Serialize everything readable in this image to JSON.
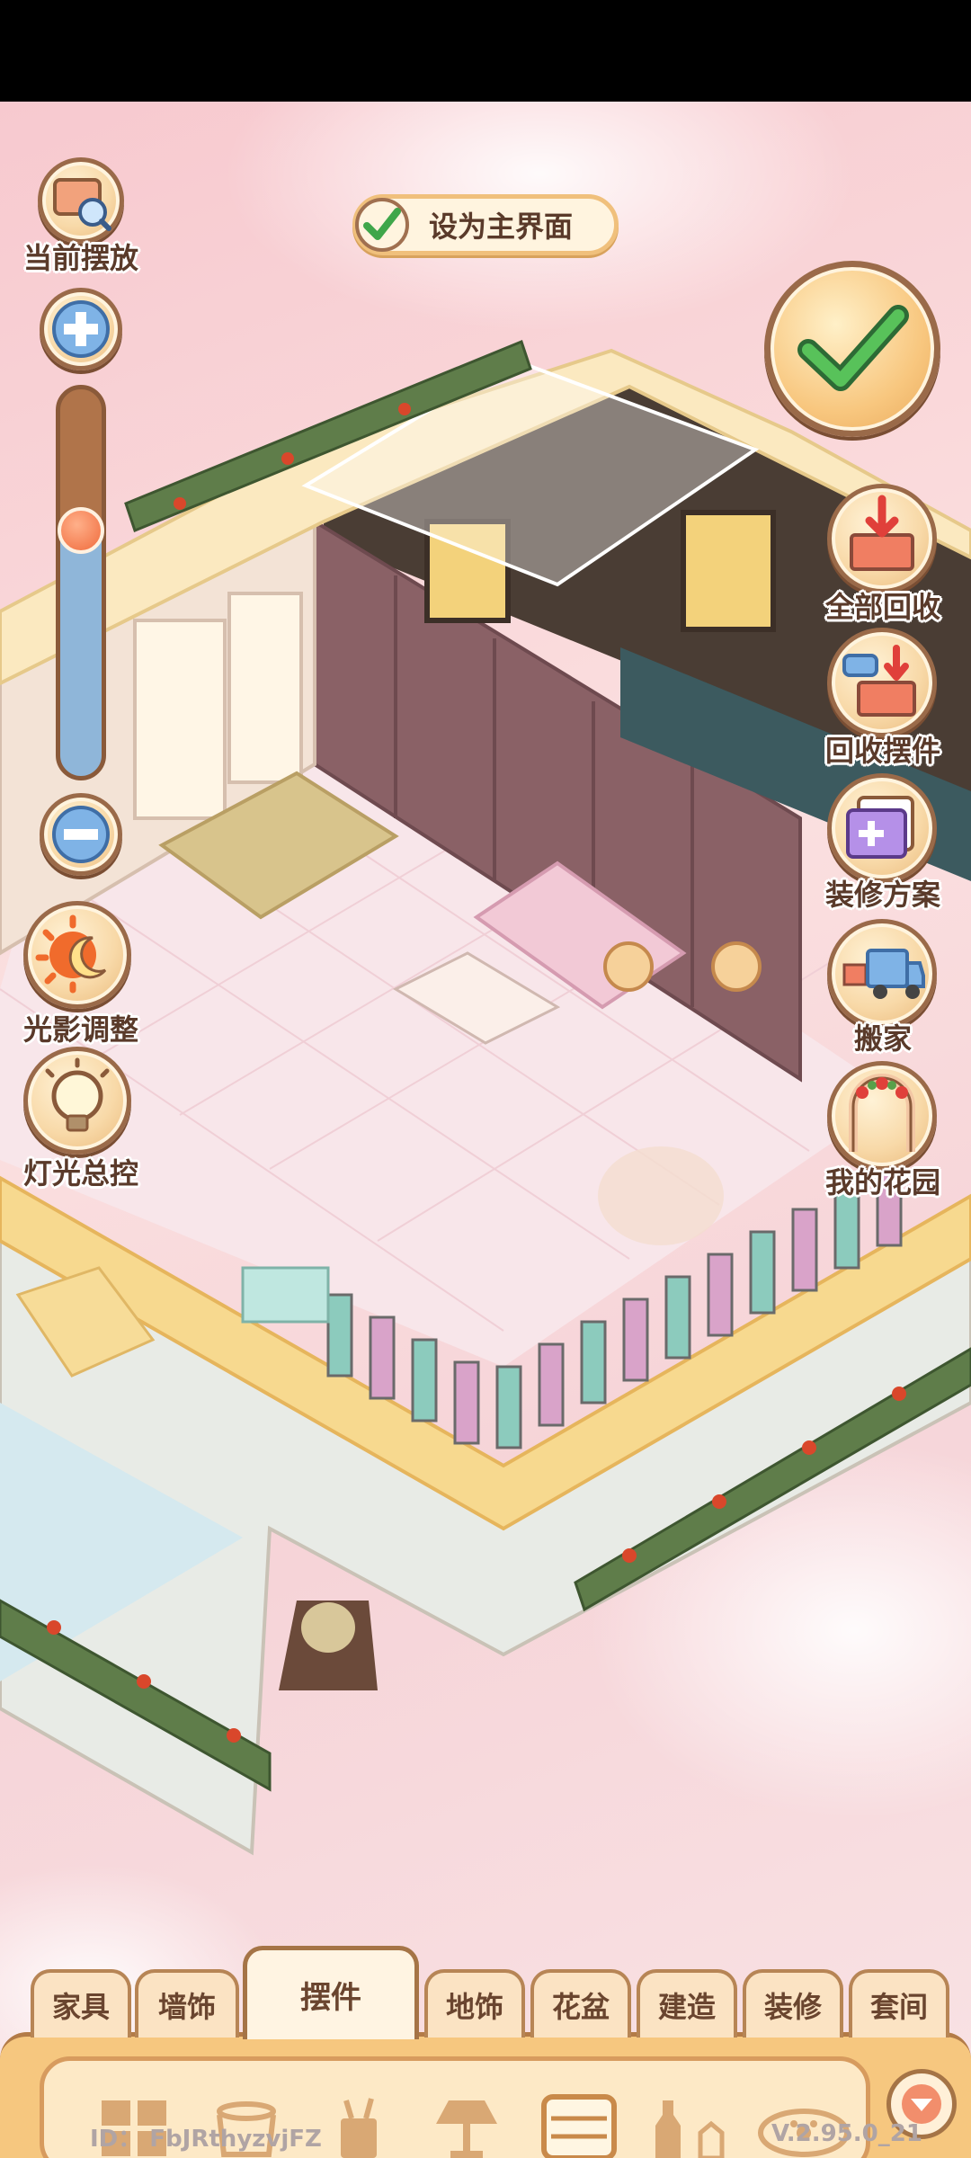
{
  "top_left": {
    "placement_label": "当前摆放"
  },
  "set_main": {
    "label": "设为主界面"
  },
  "right_menu": {
    "recycle_all": "全部回收",
    "recycle_items": "回收摆件",
    "decor_plan": "装修方案",
    "move": "搬家",
    "my_garden": "我的花园"
  },
  "left_menu": {
    "lighting_adjust": "光影调整",
    "light_control": "灯光总控"
  },
  "zoom": {
    "level": 0.65
  },
  "tabs": [
    {
      "label": "家具"
    },
    {
      "label": "墙饰"
    },
    {
      "label": "摆件"
    },
    {
      "label": "地饰"
    },
    {
      "label": "花盆"
    },
    {
      "label": "建造"
    },
    {
      "label": "装修"
    },
    {
      "label": "套间"
    }
  ],
  "active_tab": "摆件",
  "footer": {
    "id_text": "ID： FbJRthyzvjFZ",
    "version": "V.2.95.0_21"
  },
  "colors": {
    "accent": "#f0c07c",
    "brown": "#8a5a3a",
    "check_green": "#3fa64a"
  }
}
